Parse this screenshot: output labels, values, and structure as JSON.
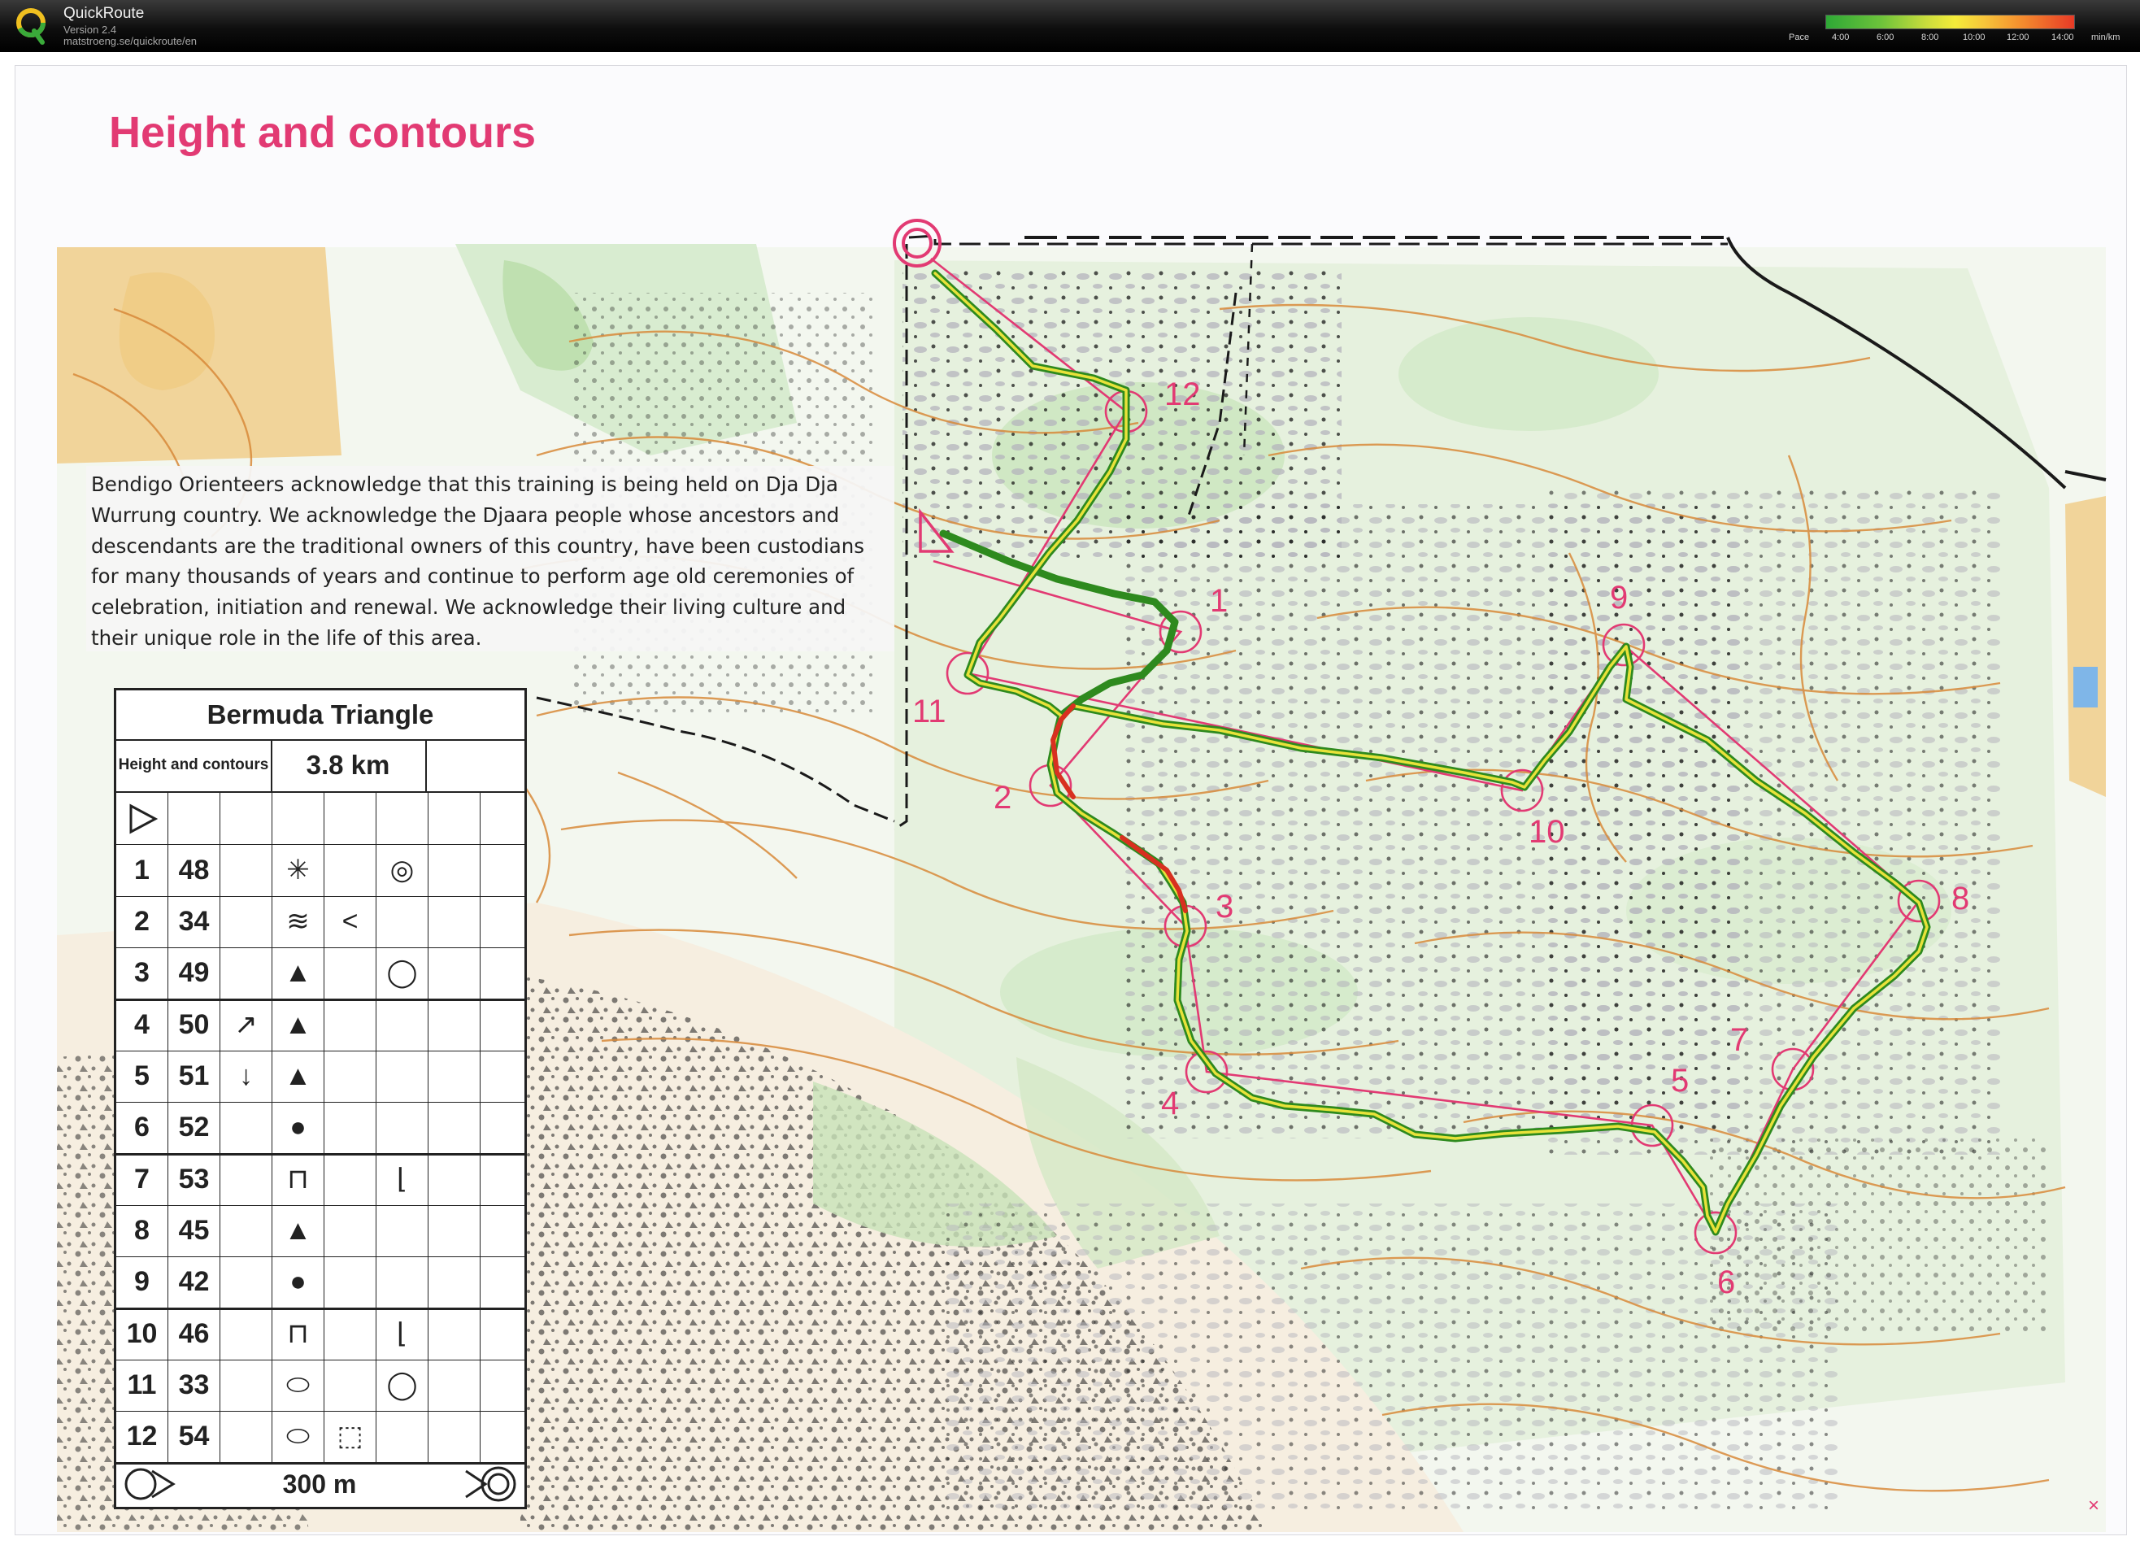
{
  "header": {
    "app_title": "QuickRoute",
    "version": "Version 2.4",
    "url": "matstroeng.se/quickroute/en",
    "pace_label": "Pace",
    "pace_ticks": [
      "4:00",
      "6:00",
      "8:00",
      "10:00",
      "12:00",
      "14:00"
    ],
    "unit": "min/km",
    "pace_colors": [
      "#2ea836",
      "#c8dc3c",
      "#f5ec3a",
      "#f5902e",
      "#e83a26"
    ]
  },
  "map": {
    "title": "Height and contours",
    "acknowledgement": [
      "Bendigo Orienteers acknowledge that this training is being held on Dja Dja",
      "Wurrung country. We acknowledge the Djaara people whose ancestors and",
      "descendants are the traditional owners of this country, have been custodians",
      "for many thousands of years and continue to perform age old ceremonies of",
      "celebration, initiation and renewal. We acknowledge their living culture and",
      "their unique role in the life of this area."
    ],
    "control_labels": [
      "1",
      "2",
      "3",
      "4",
      "5",
      "6",
      "7",
      "8",
      "9",
      "10",
      "11",
      "12"
    ],
    "course_color": "#e23a73",
    "route_colors": [
      "#2e8a1e",
      "#e8e23a",
      "#d83020"
    ],
    "close_glyph": "×"
  },
  "control_card": {
    "title": "Bermuda Triangle",
    "course_name": "Height and contours",
    "length": "3.8 km",
    "start_symbol": "triangle-start-icon",
    "controls": [
      {
        "num": "1",
        "code": "48",
        "direction": "",
        "feature": "✳",
        "detail": "",
        "position": "◎"
      },
      {
        "num": "2",
        "code": "34",
        "direction": "",
        "feature": "≋",
        "detail": "<",
        "position": ""
      },
      {
        "num": "3",
        "code": "49",
        "direction": "",
        "feature": "▲",
        "detail": "",
        "position": "◯"
      },
      {
        "num": "4",
        "code": "50",
        "direction": "↗",
        "feature": "▲",
        "detail": "",
        "position": ""
      },
      {
        "num": "5",
        "code": "51",
        "direction": "↓",
        "feature": "▲",
        "detail": "",
        "position": ""
      },
      {
        "num": "6",
        "code": "52",
        "direction": "",
        "feature": "●",
        "detail": "",
        "position": ""
      },
      {
        "num": "7",
        "code": "53",
        "direction": "",
        "feature": "⊓",
        "detail": "",
        "position": "⌊"
      },
      {
        "num": "8",
        "code": "45",
        "direction": "",
        "feature": "▲",
        "detail": "",
        "position": ""
      },
      {
        "num": "9",
        "code": "42",
        "direction": "",
        "feature": "●",
        "detail": "",
        "position": ""
      },
      {
        "num": "10",
        "code": "46",
        "direction": "",
        "feature": "⊓",
        "detail": "",
        "position": "⌊"
      },
      {
        "num": "11",
        "code": "33",
        "direction": "",
        "feature": "⬭",
        "detail": "",
        "position": "◯"
      },
      {
        "num": "12",
        "code": "54",
        "direction": "",
        "feature": "⬭",
        "detail": "⬚",
        "position": ""
      }
    ],
    "finish_distance": "300 m"
  }
}
